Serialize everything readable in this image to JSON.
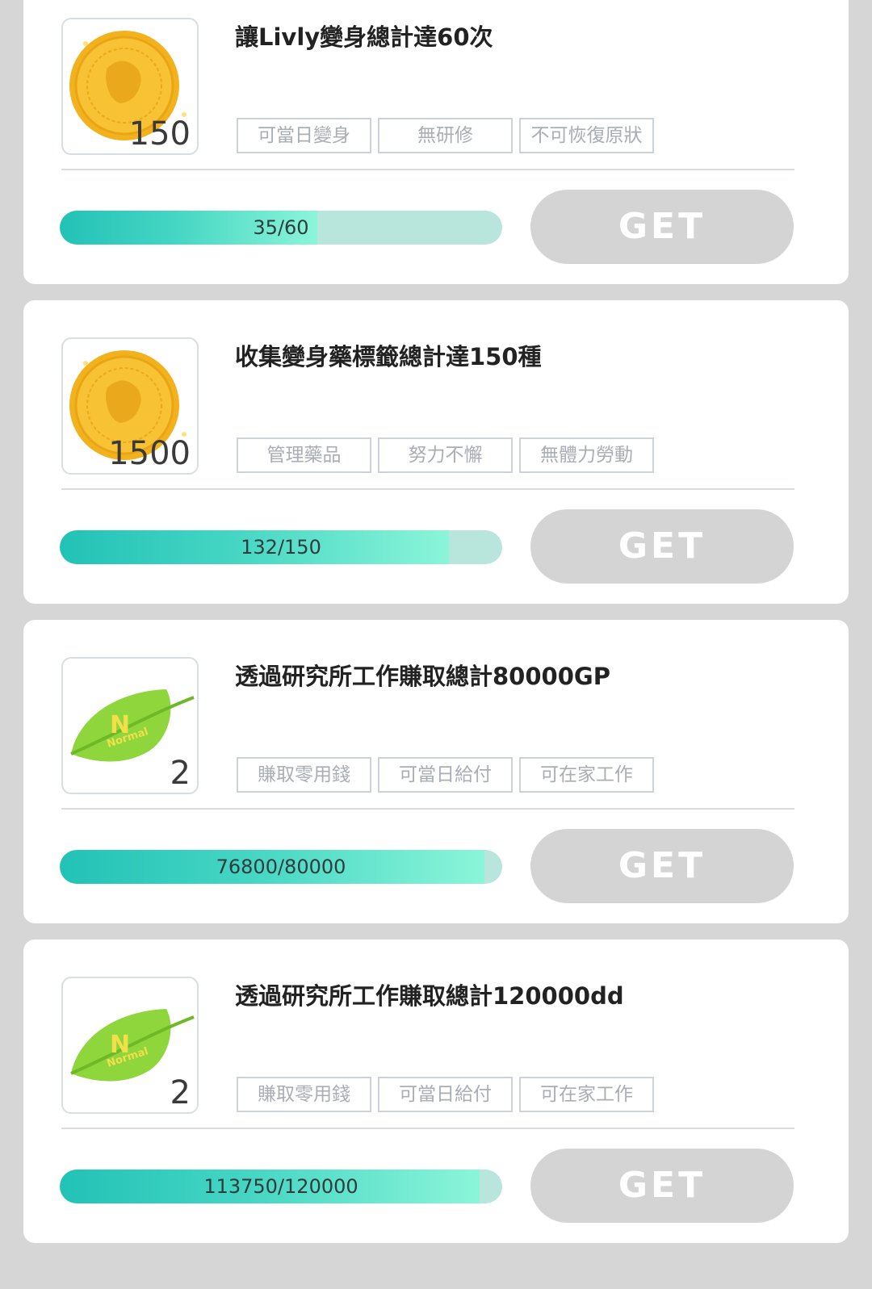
{
  "colors": {
    "background": "#d6d6d6",
    "card": "#ffffff",
    "progress_track": "#b8e6dc",
    "progress_fill_start": "#22c2b6",
    "progress_fill_end": "#8bf5d9",
    "button_disabled": "#d4d4d4"
  },
  "missions": [
    {
      "reward_icon": "gold-coin-icon",
      "reward_qty": "150",
      "title": "讓Livly變身總計達60次",
      "tags": [
        "可當日變身",
        "無研修",
        "不可恢復原狀"
      ],
      "progress_text": "35/60",
      "progress_fraction": 0.583,
      "button_label": "GET"
    },
    {
      "reward_icon": "gold-coin-icon",
      "reward_qty": "1500",
      "title": "收集變身藥標籤總計達150種",
      "tags": [
        "管理藥品",
        "努力不懈",
        "無體力勞動"
      ],
      "progress_text": "132/150",
      "progress_fraction": 0.88,
      "button_label": "GET"
    },
    {
      "reward_icon": "normal-leaf-icon",
      "reward_qty": "2",
      "title": "透過研究所工作賺取總計80000GP",
      "tags": [
        "賺取零用錢",
        "可當日給付",
        "可在家工作"
      ],
      "progress_text": "76800/80000",
      "progress_fraction": 0.96,
      "button_label": "GET"
    },
    {
      "reward_icon": "normal-leaf-icon",
      "reward_qty": "2",
      "title": "透過研究所工作賺取總計120000dd",
      "tags": [
        "賺取零用錢",
        "可當日給付",
        "可在家工作"
      ],
      "progress_text": "113750/120000",
      "progress_fraction": 0.948,
      "button_label": "GET"
    }
  ],
  "leaf_text": "Normal",
  "leaf_letter": "N"
}
